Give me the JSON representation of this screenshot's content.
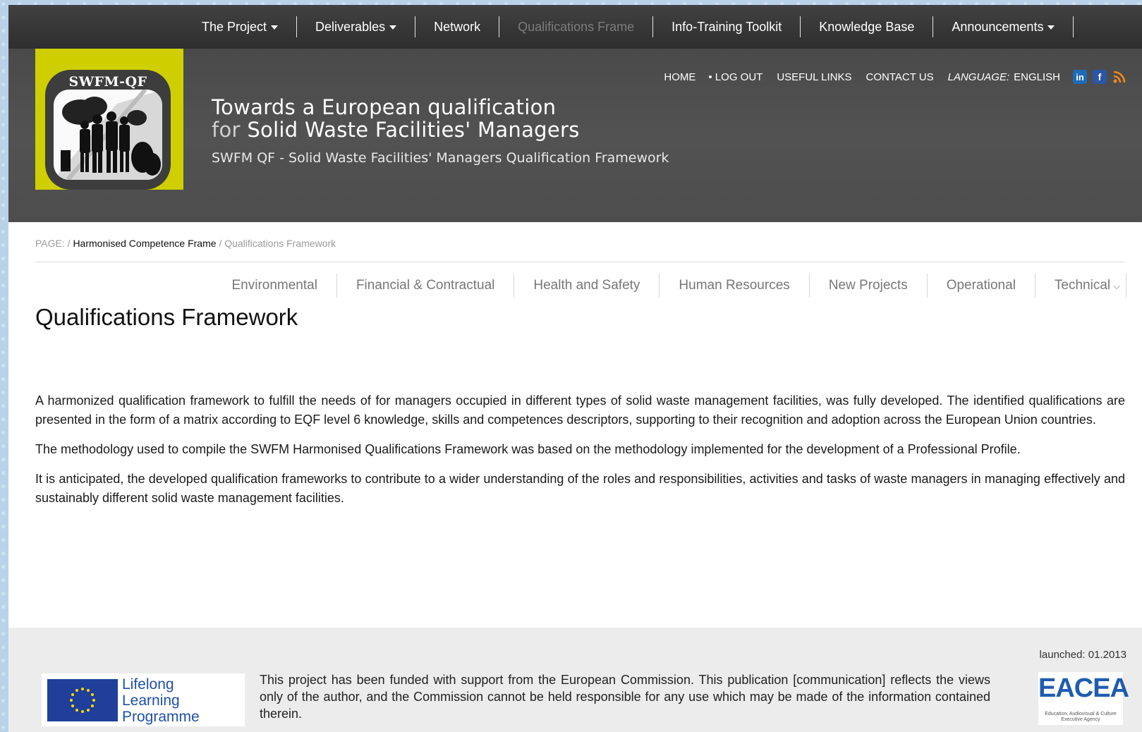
{
  "topnav": {
    "items": [
      {
        "label": "The Project",
        "dropdown": true,
        "disabled": false
      },
      {
        "label": "Deliverables",
        "dropdown": true,
        "disabled": false
      },
      {
        "label": "Network",
        "dropdown": false,
        "disabled": false
      },
      {
        "label": "Qualifications Frame",
        "dropdown": false,
        "disabled": true
      },
      {
        "label": "Info-Training Toolkit",
        "dropdown": false,
        "disabled": false
      },
      {
        "label": "Knowledge Base",
        "dropdown": false,
        "disabled": false
      },
      {
        "label": "Announcements",
        "dropdown": true,
        "disabled": false
      }
    ]
  },
  "header": {
    "logo_text": "SWFM-QF",
    "util": {
      "home": "HOME",
      "logout": "• LOG OUT",
      "useful_links": "USEFUL LINKS",
      "contact": "CONTACT US",
      "language_label": "LANGUAGE:",
      "language_value": "ENGLISH"
    },
    "social": {
      "linkedin": "in",
      "facebook": "f"
    },
    "tagline_line1": "Towards a European qualification",
    "tagline_for": "for",
    "tagline_line2": "Solid Waste Facilities' Managers",
    "subtitle": "SWFM QF - Solid Waste Facilities' Managers Qualification Framework"
  },
  "breadcrumb": {
    "prefix": "PAGE:",
    "sep1": " / ",
    "parent": "Harmonised Competence Frame",
    "sep2": " / ",
    "current": "Qualifications Framework"
  },
  "catnav": {
    "items": [
      "Environmental",
      "Financial & Contractual",
      "Health and Safety",
      "Human Resources",
      "New Projects",
      "Operational",
      "Technical"
    ]
  },
  "main": {
    "title": "Qualifications Framework",
    "paragraphs": [
      "A harmonized qualification framework to fulfill the needs of for managers occupied in different types of solid waste management facilities, was fully developed. The identified qualifications are presented in the form of a matrix according to EQF level 6 knowledge, skills and competences descriptors, supporting to their recognition and adoption across the European Union countries.",
      "The methodology used to compile the SWFM Harmonised Qualifications Framework was based on the methodology implemented for the development of a Professional Profile.",
      "It is anticipated, the developed qualification frameworks to contribute to a wider understanding of the roles and responsibilities, activities and tasks of waste managers in managing effectively and sustainably different solid waste management facilities."
    ]
  },
  "footer": {
    "launched": "launched: 01.2013",
    "llp_line1": "Lifelong",
    "llp_line2": "Learning",
    "llp_line3": "Programme",
    "disclaimer": "This project has been funded with support from the European Commission. This publication [communication] reflects the views only of the author, and the Commission cannot be held responsible for any use which may be made of the information contained therein.",
    "eacea_logo": "EACEA",
    "eacea_small": "Education, Audiovisual & Culture Executive Agency"
  },
  "colors": {
    "accent_yellow": "#cfcf00",
    "header_gray": "#4d4d4d",
    "nav_dark": "#363636",
    "eu_blue": "#1f3f9b"
  }
}
